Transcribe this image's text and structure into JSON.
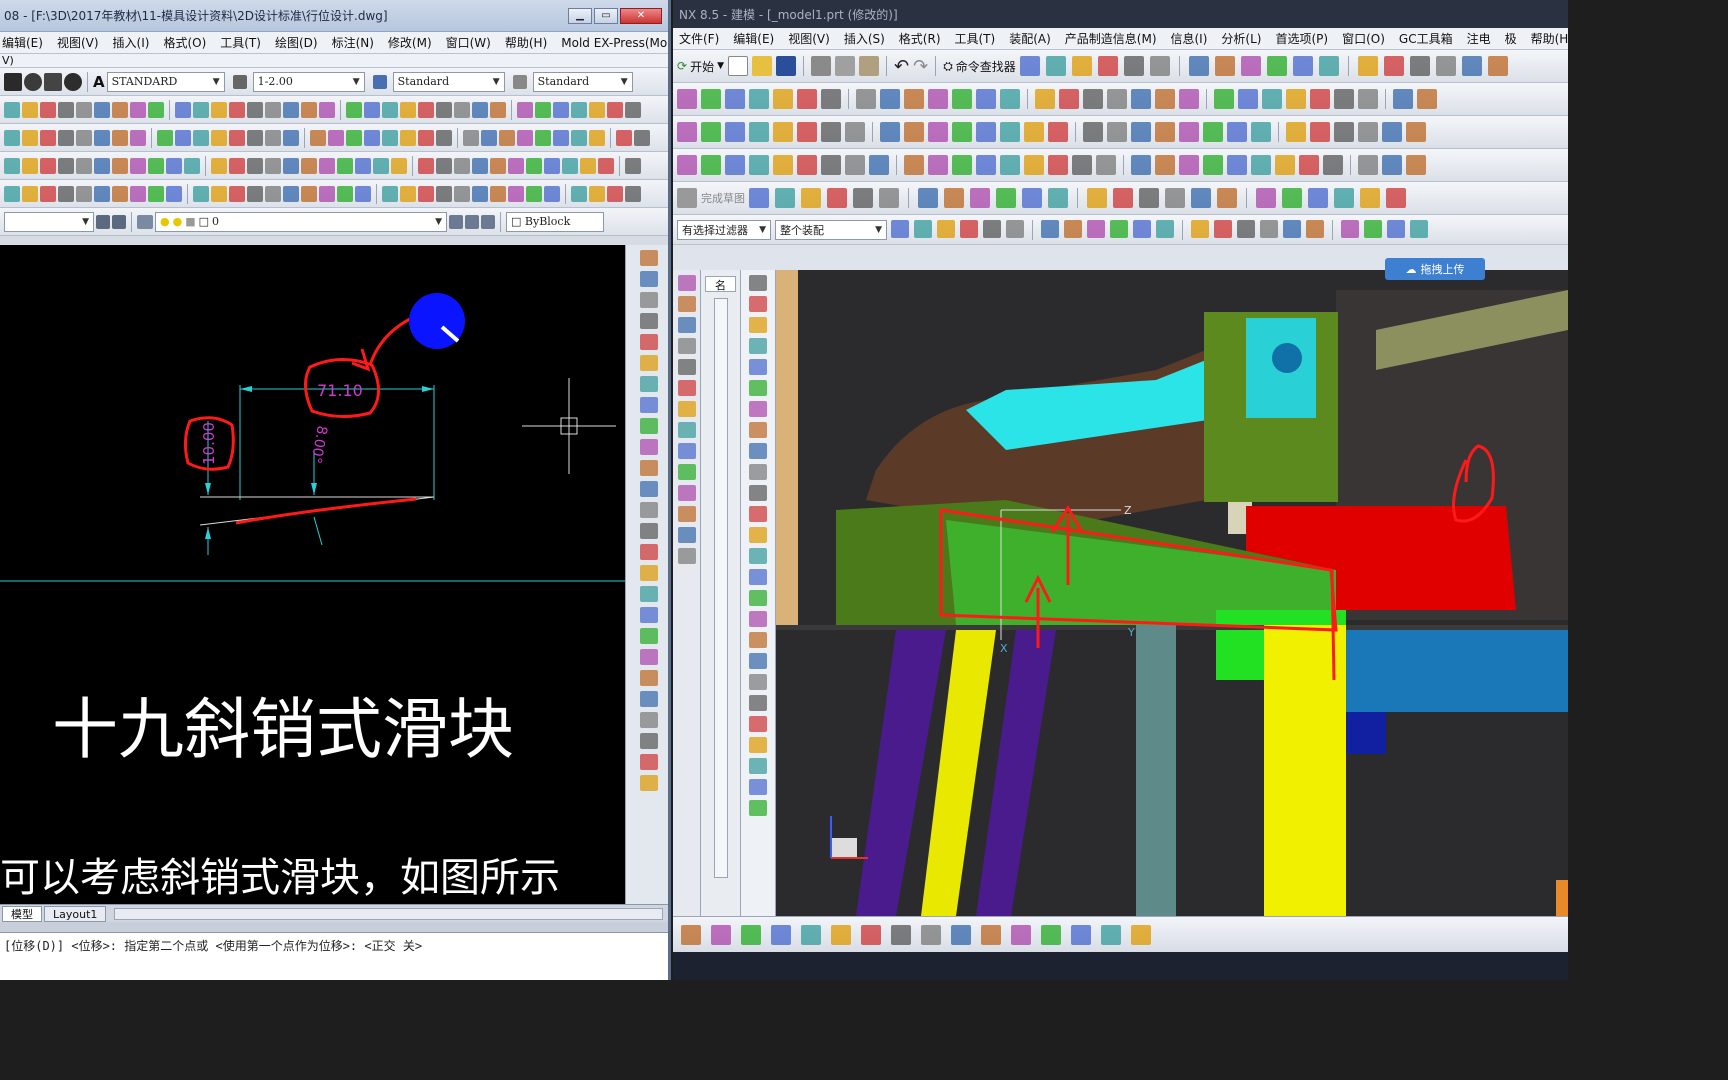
{
  "cad": {
    "title": "08 - [F:\\3D\\2017年教材\\11-模具设计资料\\2D设计标准\\行位设计.dwg]",
    "menu": [
      "编辑(E)",
      "视图(V)",
      "插入(I)",
      "格式(O)",
      "工具(T)",
      "绘图(D)",
      "标注(N)",
      "修改(M)",
      "窗口(W)",
      "帮助(H)",
      "Mold EX-Press(Mold)"
    ],
    "menu_left": "]",
    "menu_row2": "V)",
    "text_style": "STANDARD",
    "dim_scale": "1-2.00",
    "dim_style": "Standard",
    "table_style": "Standard",
    "layer": "0",
    "linetype": "ByBlock",
    "dim_width": "71.10",
    "dim_height": "10.00",
    "dim_angle": "8.00°",
    "title_text": "十九斜销式滑块",
    "subtitle_text": "可以考虑斜销式滑块，如图所示",
    "tabs": [
      "模型",
      "Layout1"
    ],
    "command": "[位移(D)] <位移>:  指定第二个点或 <使用第一个点作为位移>:  <正交 关>"
  },
  "nx": {
    "title": "NX 8.5 - 建模 - [_model1.prt (修改的)]",
    "menu": [
      "文件(F)",
      "编辑(E)",
      "视图(V)",
      "插入(S)",
      "格式(R)",
      "工具(T)",
      "装配(A)",
      "产品制造信息(M)",
      "信息(I)",
      "分析(L)",
      "首选项(P)",
      "窗口(O)",
      "GC工具箱",
      "注电",
      "极",
      "帮助(H)"
    ],
    "start": "开始",
    "command_finder": "命令查找器",
    "finish_sketch": "完成草图",
    "filter": "有选择过滤器",
    "assembly": "整个装配",
    "upload": "拖拽上传",
    "nav_label": "名"
  },
  "colors": {
    "cad_dim": "#cf3bd0",
    "cad_ext": "#29d0d6",
    "annotation": "#ff1a1a",
    "cursor_dot": "#0a14ff"
  }
}
